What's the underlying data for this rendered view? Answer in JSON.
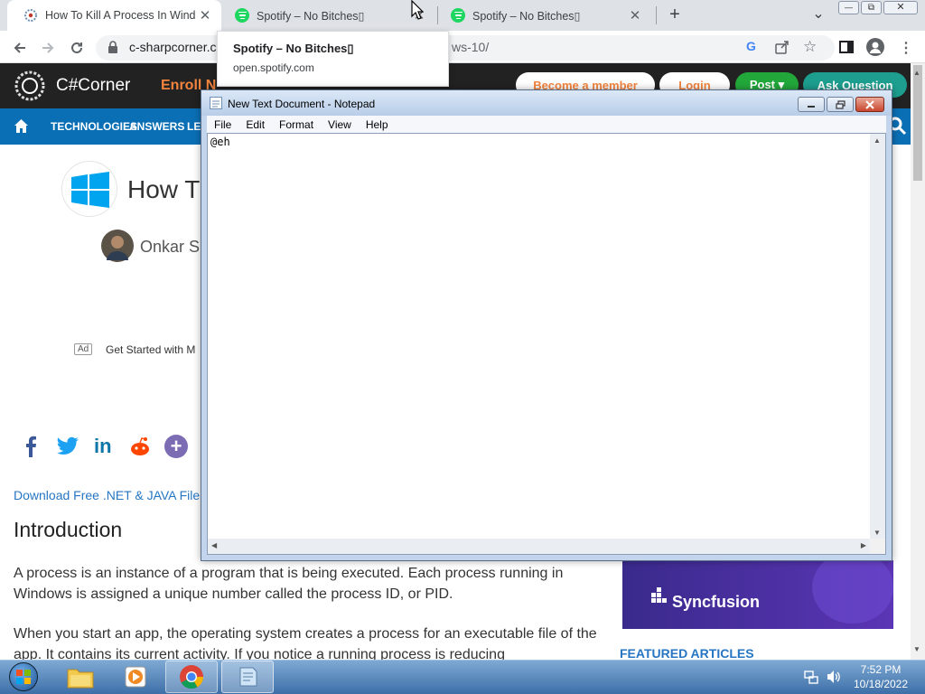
{
  "browser": {
    "tabs": [
      {
        "title": "How To Kill A Process In Window",
        "close": "✕",
        "favicon": "csharpcorner-favicon"
      },
      {
        "title": "Spotify – No Bitches▯",
        "close": "✕",
        "favicon": "spotify-favicon"
      },
      {
        "title": "Spotify – No Bitches▯",
        "close": "✕",
        "favicon": "spotify-favicon"
      }
    ],
    "new_tab": "+",
    "tab_menu": "⌄",
    "url_host": "c-sharpcorner.co",
    "url_path_tail": "ws-10/",
    "tooltip": {
      "title": "Spotify – No Bitches▯",
      "host": "open.spotify.com"
    },
    "window_controls": {
      "minimize": "—",
      "maximize": "⧉",
      "close": "✕"
    }
  },
  "website": {
    "logo_text": "C#Corner",
    "enroll_fragment": "Enroll N",
    "header_buttons": [
      "Become a member",
      "Login",
      "Post ▾",
      "Ask Question"
    ],
    "nav": [
      "TECHNOLOGIES",
      "ANSWERS",
      "LEA"
    ],
    "article_title_fragment": "How T",
    "author_fragment": "Onkar S",
    "ad_badge": "Ad",
    "ad_text": "Get Started with M",
    "download_link": "Download Free .NET & JAVA File",
    "intro_heading": "Introduction",
    "para1": "A process is an instance of a program that is being executed. Each process running in Windows is assigned a unique number called the process ID, or PID.",
    "para2": "When you start an app, the operating system creates a process for an executable file of the app. It contains its current activity. If you notice a running process is reducing",
    "sponsor": "Syncfusion",
    "featured": "FEATURED ARTICLES"
  },
  "notepad": {
    "title": "New Text Document - Notepad",
    "menu": [
      "File",
      "Edit",
      "Format",
      "View",
      "Help"
    ],
    "content": "@eh"
  },
  "taskbar": {
    "time": "7:52 PM",
    "date": "10/18/2022"
  }
}
